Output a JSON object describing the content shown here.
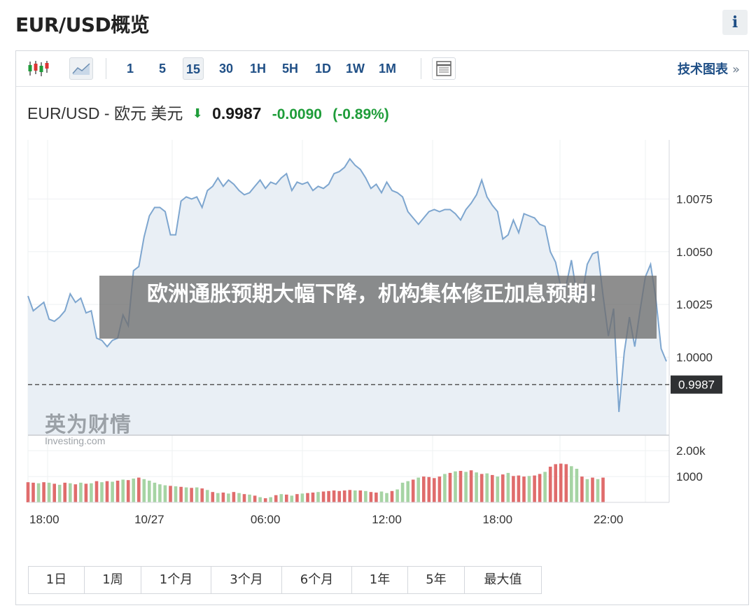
{
  "page": {
    "title": "EUR/USD概览",
    "info_glyph": "i"
  },
  "toolbar": {
    "intervals": [
      "1",
      "5",
      "15",
      "30",
      "1H",
      "5H",
      "1D",
      "1W",
      "1M"
    ],
    "active_interval": "15",
    "tech_chart_link": "技术图表",
    "tech_chart_arrow": "»"
  },
  "quote": {
    "pair": "EUR/USD - 欧元 美元",
    "price": "0.9987",
    "change": "-0.0090",
    "change_pct": "(-0.89%)"
  },
  "ranges": [
    "1日",
    "1周",
    "1个月",
    "3个月",
    "6个月",
    "1年",
    "5年",
    "最大值"
  ],
  "overlay": {
    "headline": "欧洲通胀预期大幅下降，机构集体修正加息预期！"
  },
  "watermark": {
    "cn": "英为财情",
    "en_bold": "Investing",
    "en_suffix": ".com"
  },
  "colors": {
    "line": "#7ea6cf",
    "area": "#e8eef4",
    "up": "#a6d4a4",
    "down": "#e06c6c",
    "accent": "#1f4f86",
    "positive": "#1f9d3a"
  },
  "chart_data": {
    "type": "area",
    "series": [
      {
        "values": [
          1.0029,
          1.0022,
          1.0024,
          1.0026,
          1.0018,
          1.0017,
          1.0019,
          1.0022,
          1.003,
          1.0026,
          1.0028,
          1.0021,
          1.0022,
          1.0009,
          1.0008,
          1.0005,
          1.0008,
          1.0009,
          1.002,
          1.0015,
          1.0041,
          1.0043,
          1.0057,
          1.0067,
          1.0071,
          1.0071,
          1.0069,
          1.0058,
          1.0058,
          1.0074,
          1.0076,
          1.0075,
          1.0076,
          1.0071,
          1.0079,
          1.0081,
          1.0085,
          1.0081,
          1.0084,
          1.0082,
          1.0079,
          1.0077,
          1.0078,
          1.0081,
          1.0084,
          1.008,
          1.0083,
          1.0082,
          1.0085,
          1.0087,
          1.0079,
          1.0083,
          1.0082,
          1.0083,
          1.0079,
          1.0081,
          1.008,
          1.0082,
          1.0087,
          1.0088,
          1.009,
          1.0094,
          1.0091,
          1.0089,
          1.0085,
          1.008,
          1.0082,
          1.0078,
          1.0083,
          1.0079,
          1.0078,
          1.0076,
          1.0069,
          1.0066,
          1.0063,
          1.0066,
          1.0069,
          1.007,
          1.0069,
          1.007,
          1.007,
          1.0068,
          1.0065,
          1.007,
          1.0073,
          1.0077,
          1.0084,
          1.0076,
          1.0072,
          1.0069,
          1.0056,
          1.0058,
          1.0065,
          1.0059,
          1.0068,
          1.0067,
          1.0066,
          1.0063,
          1.0062,
          1.005,
          1.0045,
          1.0033,
          1.0034,
          1.0046,
          1.003,
          1.0029,
          1.0044,
          1.0049,
          1.005,
          1.0029,
          1.001,
          1.0023,
          0.9974,
          1.0002,
          1.0019,
          1.0005,
          1.0022,
          1.0038,
          1.0044,
          1.0028,
          1.0004,
          0.9998
        ]
      }
    ],
    "volume": [
      {
        "v": 780,
        "down": true
      },
      {
        "v": 760,
        "down": true
      },
      {
        "v": 740,
        "down": false
      },
      {
        "v": 780,
        "down": true
      },
      {
        "v": 760,
        "down": false
      },
      {
        "v": 720,
        "down": true
      },
      {
        "v": 680,
        "down": false
      },
      {
        "v": 760,
        "down": true
      },
      {
        "v": 740,
        "down": false
      },
      {
        "v": 700,
        "down": true
      },
      {
        "v": 760,
        "down": false
      },
      {
        "v": 720,
        "down": true
      },
      {
        "v": 740,
        "down": false
      },
      {
        "v": 820,
        "down": true
      },
      {
        "v": 780,
        "down": false
      },
      {
        "v": 820,
        "down": true
      },
      {
        "v": 800,
        "down": false
      },
      {
        "v": 840,
        "down": true
      },
      {
        "v": 880,
        "down": false
      },
      {
        "v": 860,
        "down": true
      },
      {
        "v": 920,
        "down": false
      },
      {
        "v": 960,
        "down": true
      },
      {
        "v": 900,
        "down": false
      },
      {
        "v": 840,
        "down": false
      },
      {
        "v": 760,
        "down": false
      },
      {
        "v": 700,
        "down": false
      },
      {
        "v": 660,
        "down": false
      },
      {
        "v": 640,
        "down": true
      },
      {
        "v": 620,
        "down": false
      },
      {
        "v": 600,
        "down": true
      },
      {
        "v": 580,
        "down": false
      },
      {
        "v": 560,
        "down": true
      },
      {
        "v": 580,
        "down": false
      },
      {
        "v": 540,
        "down": true
      },
      {
        "v": 480,
        "down": false
      },
      {
        "v": 400,
        "down": true
      },
      {
        "v": 360,
        "down": false
      },
      {
        "v": 380,
        "down": true
      },
      {
        "v": 340,
        "down": false
      },
      {
        "v": 400,
        "down": true
      },
      {
        "v": 360,
        "down": false
      },
      {
        "v": 320,
        "down": true
      },
      {
        "v": 300,
        "down": false
      },
      {
        "v": 260,
        "down": true
      },
      {
        "v": 200,
        "down": false
      },
      {
        "v": 160,
        "down": true
      },
      {
        "v": 200,
        "down": false
      },
      {
        "v": 280,
        "down": true
      },
      {
        "v": 320,
        "down": false
      },
      {
        "v": 300,
        "down": true
      },
      {
        "v": 260,
        "down": false
      },
      {
        "v": 320,
        "down": true
      },
      {
        "v": 340,
        "down": false
      },
      {
        "v": 360,
        "down": true
      },
      {
        "v": 380,
        "down": true
      },
      {
        "v": 400,
        "down": false
      },
      {
        "v": 420,
        "down": true
      },
      {
        "v": 440,
        "down": true
      },
      {
        "v": 460,
        "down": true
      },
      {
        "v": 440,
        "down": true
      },
      {
        "v": 460,
        "down": true
      },
      {
        "v": 480,
        "down": true
      },
      {
        "v": 460,
        "down": false
      },
      {
        "v": 460,
        "down": true
      },
      {
        "v": 440,
        "down": false
      },
      {
        "v": 400,
        "down": true
      },
      {
        "v": 380,
        "down": true
      },
      {
        "v": 420,
        "down": false
      },
      {
        "v": 360,
        "down": false
      },
      {
        "v": 440,
        "down": true
      },
      {
        "v": 500,
        "down": false
      },
      {
        "v": 760,
        "down": false
      },
      {
        "v": 820,
        "down": false
      },
      {
        "v": 880,
        "down": true
      },
      {
        "v": 960,
        "down": false
      },
      {
        "v": 1000,
        "down": true
      },
      {
        "v": 980,
        "down": true
      },
      {
        "v": 940,
        "down": true
      },
      {
        "v": 1000,
        "down": true
      },
      {
        "v": 1100,
        "down": false
      },
      {
        "v": 1140,
        "down": true
      },
      {
        "v": 1200,
        "down": false
      },
      {
        "v": 1220,
        "down": true
      },
      {
        "v": 1180,
        "down": false
      },
      {
        "v": 1240,
        "down": true
      },
      {
        "v": 1160,
        "down": false
      },
      {
        "v": 1100,
        "down": true
      },
      {
        "v": 1120,
        "down": false
      },
      {
        "v": 1060,
        "down": true
      },
      {
        "v": 1000,
        "down": false
      },
      {
        "v": 1080,
        "down": true
      },
      {
        "v": 1140,
        "down": false
      },
      {
        "v": 1020,
        "down": true
      },
      {
        "v": 1040,
        "down": true
      },
      {
        "v": 1000,
        "down": true
      },
      {
        "v": 1020,
        "down": false
      },
      {
        "v": 1040,
        "down": true
      },
      {
        "v": 1100,
        "down": true
      },
      {
        "v": 1180,
        "down": false
      },
      {
        "v": 1380,
        "down": true
      },
      {
        "v": 1480,
        "down": true
      },
      {
        "v": 1500,
        "down": true
      },
      {
        "v": 1480,
        "down": true
      },
      {
        "v": 1400,
        "down": false
      },
      {
        "v": 1300,
        "down": false
      },
      {
        "v": 1000,
        "down": true
      },
      {
        "v": 900,
        "down": false
      },
      {
        "v": 960,
        "down": true
      },
      {
        "v": 900,
        "down": false
      },
      {
        "v": 960,
        "down": true
      }
    ],
    "current_value": 0.9987,
    "current_label": "0.9987",
    "ylim": [
      0.9963,
      1.0103
    ],
    "yticks": [
      1.0075,
      1.005,
      1.0025,
      1.0
    ],
    "ytick_labels": [
      "1.0075",
      "1.0050",
      "1.0025",
      "1.0000"
    ],
    "volume_ylim": [
      0,
      2600
    ],
    "volume_ticks": [
      2000,
      1000
    ],
    "volume_tick_labels": [
      "2.00k",
      "1000"
    ],
    "xtick_labels": [
      "18:00",
      "10/27",
      "06:00",
      "12:00",
      "18:00",
      "22:00"
    ],
    "xtick_index": [
      2,
      23,
      45,
      68,
      89,
      110
    ],
    "grid": true
  }
}
